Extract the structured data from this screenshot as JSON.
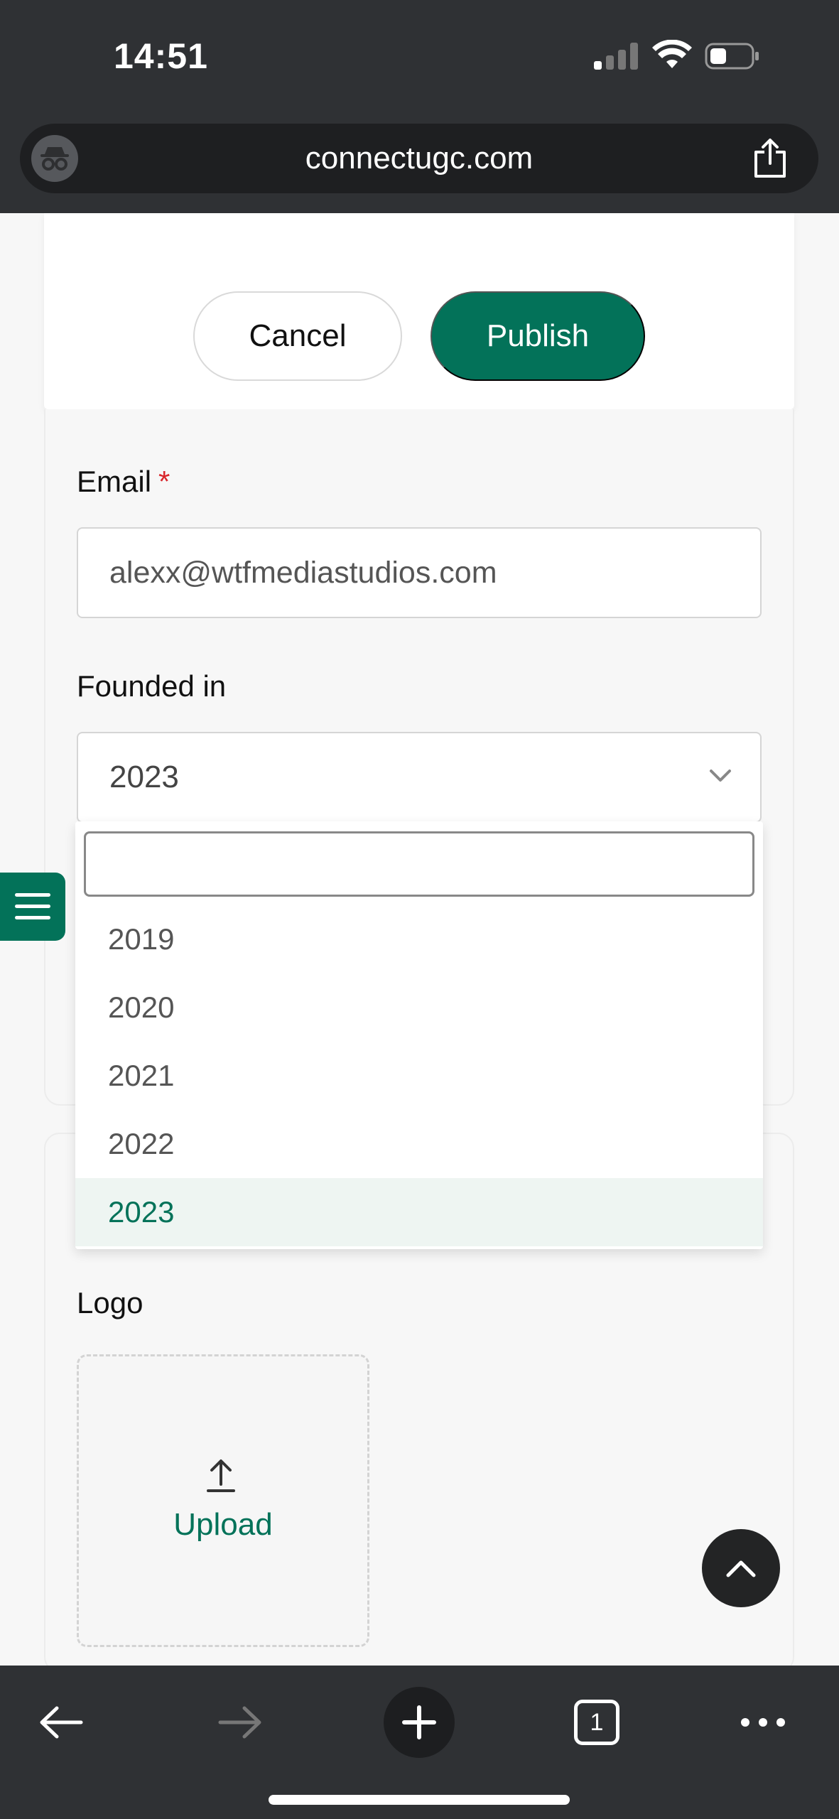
{
  "status_bar": {
    "time": "14:51"
  },
  "browser": {
    "url": "connectugc.com",
    "tab_count": "1"
  },
  "form": {
    "cancel_label": "Cancel",
    "publish_label": "Publish",
    "email": {
      "label": "Email",
      "required_mark": "*",
      "value": "alexx@wtfmediastudios.com"
    },
    "founded": {
      "label": "Founded in",
      "value": "2023",
      "options": [
        "2019",
        "2020",
        "2021",
        "2022",
        "2023"
      ],
      "selected": "2023"
    },
    "logo": {
      "label": "Logo",
      "upload_label": "Upload"
    }
  },
  "colors": {
    "brand": "#037259",
    "required": "#d9262c",
    "chrome": "#2f3134"
  },
  "icons": [
    "incognito-icon",
    "share-icon",
    "chevron-down-icon",
    "menu-icon",
    "upload-icon",
    "chevron-up-icon",
    "back-arrow-icon",
    "forward-arrow-icon",
    "plus-icon"
  ]
}
